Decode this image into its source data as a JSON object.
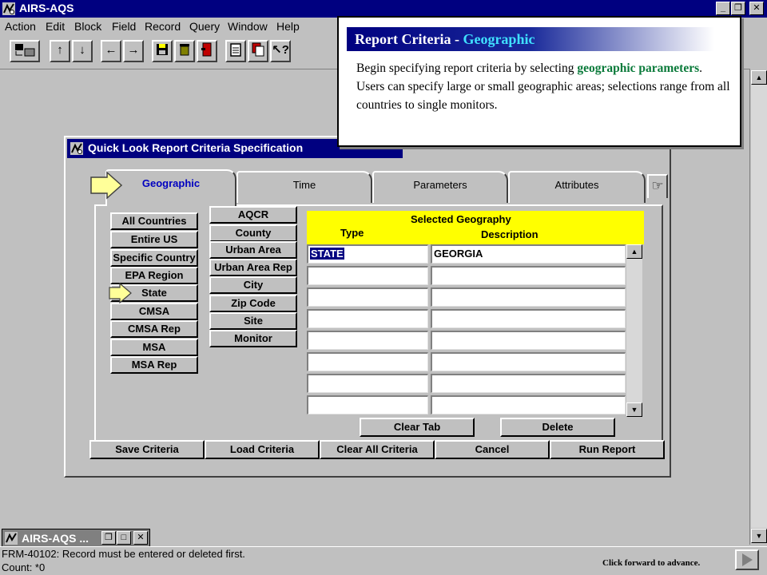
{
  "app": {
    "title": "AIRS-AQS",
    "window_controls": [
      "_",
      "❐",
      "✕"
    ]
  },
  "menu": [
    "Action",
    "Edit",
    "Block",
    "Field",
    "Record",
    "Query",
    "Window",
    "Help"
  ],
  "toolbar": {
    "buttons": [
      "enter-query-icon",
      "up-arrow-icon",
      "down-arrow-icon",
      "left-arrow-icon",
      "right-arrow-icon",
      "save-icon",
      "trash-icon",
      "exit-icon",
      "clipboard-icon",
      "copy-icon",
      "help-icon"
    ]
  },
  "dialog": {
    "title": "Quick Look Report Criteria Specification",
    "tabs": [
      "Geographic",
      "Time",
      "Parameters",
      "Attributes"
    ],
    "geo_left": [
      "All Countries",
      "Entire US",
      "Specific Country",
      "EPA Region",
      "State",
      "CMSA",
      "CMSA Rep",
      "MSA",
      "MSA Rep"
    ],
    "geo_right": [
      "AQCR",
      "County",
      "Urban Area",
      "Urban Area Rep",
      "City",
      "Zip Code",
      "Site",
      "Monitor"
    ],
    "grid": {
      "title": "Selected Geography",
      "col_type": "Type",
      "col_desc": "Description",
      "rows": [
        {
          "type": "STATE",
          "desc": "GEORGIA"
        },
        {
          "type": "",
          "desc": ""
        },
        {
          "type": "",
          "desc": ""
        },
        {
          "type": "",
          "desc": ""
        },
        {
          "type": "",
          "desc": ""
        },
        {
          "type": "",
          "desc": ""
        },
        {
          "type": "",
          "desc": ""
        },
        {
          "type": "",
          "desc": ""
        }
      ]
    },
    "grid_buttons": [
      "Clear Tab",
      "Delete"
    ],
    "bottom_buttons": [
      "Save Criteria",
      "Load Criteria",
      "Clear All Criteria",
      "Cancel",
      "Run Report"
    ]
  },
  "callout": {
    "heading_main": "Report Criteria - ",
    "heading_accent": "Geographic",
    "body_1": "Begin specifying report criteria by selecting ",
    "body_kw": "geographic parameters",
    "body_2": ".  Users can specify large or small geographic areas; selections range from all countries to single monitors."
  },
  "minimized": {
    "title": "AIRS-AQS ..."
  },
  "status": {
    "message": "FRM-40102: Record must be entered or deleted first.",
    "count": "Count: *0",
    "advance": "Click forward to advance."
  },
  "colors": {
    "titlebar": "#000080",
    "grid_header": "#ffff00",
    "pointer": "#ffff99",
    "accent_text": "#0a7a3a"
  }
}
